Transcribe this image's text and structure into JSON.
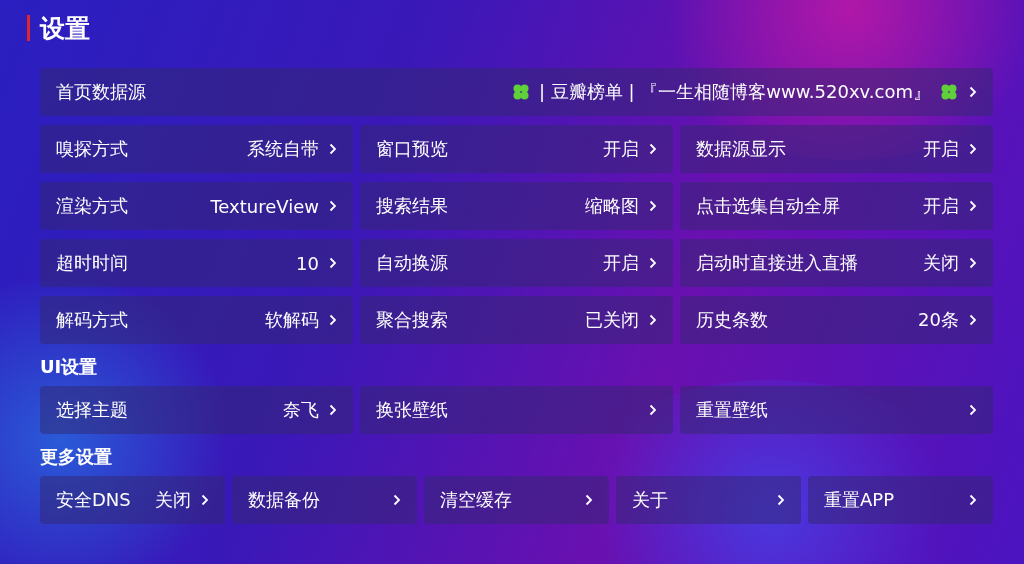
{
  "title": "设置",
  "sections": [
    {
      "items": [
        {
          "label": "首页数据源",
          "value": "| 豆瓣榜单 | 『一生相随博客www.520xv.com』",
          "decorated": true
        }
      ]
    },
    {
      "items": [
        {
          "label": "嗅探方式",
          "value": "系统自带"
        },
        {
          "label": "窗口预览",
          "value": "开启"
        },
        {
          "label": "数据源显示",
          "value": "开启"
        },
        {
          "label": "渲染方式",
          "value": "TextureView"
        },
        {
          "label": "搜索结果",
          "value": "缩略图"
        },
        {
          "label": "点击选集自动全屏",
          "value": "开启"
        },
        {
          "label": "超时时间",
          "value": "10"
        },
        {
          "label": "自动换源",
          "value": "开启"
        },
        {
          "label": "启动时直接进入直播",
          "value": "关闭"
        },
        {
          "label": "解码方式",
          "value": "软解码"
        },
        {
          "label": "聚合搜索",
          "value": "已关闭"
        },
        {
          "label": "历史条数",
          "value": "20条"
        }
      ]
    },
    {
      "heading": "UI设置",
      "items": [
        {
          "label": "选择主题",
          "value": "奈飞"
        },
        {
          "label": "换张壁纸"
        },
        {
          "label": "重置壁纸"
        }
      ]
    },
    {
      "heading": "更多设置",
      "items": [
        {
          "label": "安全DNS",
          "value": "关闭"
        },
        {
          "label": "数据备份"
        },
        {
          "label": "清空缓存"
        },
        {
          "label": "关于"
        },
        {
          "label": "重置APP"
        }
      ]
    }
  ]
}
